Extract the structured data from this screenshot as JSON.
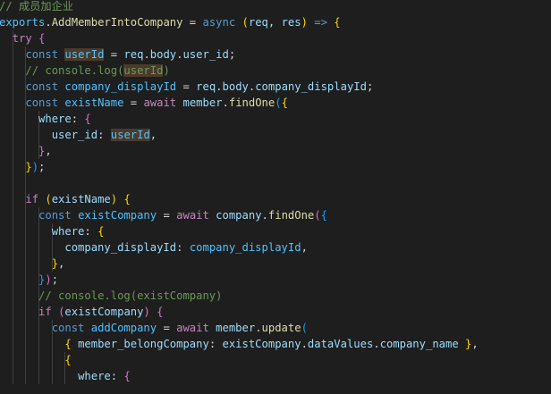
{
  "editor": {
    "theme_colors": {
      "background": "#1e1e1e",
      "comment": "#6a9955",
      "keyword": "#569cd6",
      "control": "#c586c0",
      "variable": "#9cdcfe",
      "const": "#4fc1ff",
      "function": "#dcdcaa",
      "plain": "#d4d4d4",
      "bracket_gold": "#ffd700",
      "bracket_orchid": "#da70d6",
      "bracket_blue": "#179fff",
      "highlight": "#4b3a2a"
    },
    "lines": [
      [
        [
          "comment",
          "// 成员加企业"
        ]
      ],
      [
        [
          "const",
          "exports"
        ],
        [
          "plain",
          "."
        ],
        [
          "func",
          "AddMemberIntoCompany"
        ],
        [
          "plain",
          " = "
        ],
        [
          "keyword",
          "async"
        ],
        [
          "plain",
          " "
        ],
        [
          "b1",
          "("
        ],
        [
          "variable",
          "req"
        ],
        [
          "plain",
          ", "
        ],
        [
          "variable",
          "res"
        ],
        [
          "b1",
          ")"
        ],
        [
          "plain",
          " "
        ],
        [
          "keyword",
          "=>"
        ],
        [
          "plain",
          " "
        ],
        [
          "b1",
          "{"
        ]
      ],
      [
        [
          "plain",
          "  "
        ],
        [
          "control",
          "try"
        ],
        [
          "plain",
          " "
        ],
        [
          "b2",
          "{"
        ]
      ],
      [
        [
          "plain",
          "    "
        ],
        [
          "keyword",
          "const"
        ],
        [
          "plain",
          " "
        ],
        [
          "const_hl",
          "userId"
        ],
        [
          "plain",
          " = "
        ],
        [
          "variable",
          "req"
        ],
        [
          "plain",
          "."
        ],
        [
          "variable",
          "body"
        ],
        [
          "plain",
          "."
        ],
        [
          "variable",
          "user_id"
        ],
        [
          "plain",
          ";"
        ]
      ],
      [
        [
          "plain",
          "    "
        ],
        [
          "comment",
          "// console.log("
        ],
        [
          "comment_hl",
          "userId"
        ],
        [
          "comment",
          ")"
        ]
      ],
      [
        [
          "plain",
          "    "
        ],
        [
          "keyword",
          "const"
        ],
        [
          "plain",
          " "
        ],
        [
          "const",
          "company_displayId"
        ],
        [
          "plain",
          " = "
        ],
        [
          "variable",
          "req"
        ],
        [
          "plain",
          "."
        ],
        [
          "variable",
          "body"
        ],
        [
          "plain",
          "."
        ],
        [
          "variable",
          "company_displayId"
        ],
        [
          "plain",
          ";"
        ]
      ],
      [
        [
          "plain",
          "    "
        ],
        [
          "keyword",
          "const"
        ],
        [
          "plain",
          " "
        ],
        [
          "const",
          "existName"
        ],
        [
          "plain",
          " = "
        ],
        [
          "control",
          "await"
        ],
        [
          "plain",
          " "
        ],
        [
          "variable",
          "member"
        ],
        [
          "plain",
          "."
        ],
        [
          "func",
          "findOne"
        ],
        [
          "b3",
          "("
        ],
        [
          "b1",
          "{"
        ]
      ],
      [
        [
          "plain",
          "      "
        ],
        [
          "variable",
          "where"
        ],
        [
          "plain",
          ": "
        ],
        [
          "b2",
          "{"
        ]
      ],
      [
        [
          "plain",
          "        "
        ],
        [
          "variable",
          "user_id"
        ],
        [
          "plain",
          ": "
        ],
        [
          "const_hl",
          "userId"
        ],
        [
          "plain",
          ","
        ]
      ],
      [
        [
          "plain",
          "      "
        ],
        [
          "b2",
          "}"
        ],
        [
          "plain",
          ","
        ]
      ],
      [
        [
          "plain",
          "    "
        ],
        [
          "b1",
          "}"
        ],
        [
          "b3",
          ")"
        ],
        [
          "plain",
          ";"
        ]
      ],
      [],
      [
        [
          "plain",
          "    "
        ],
        [
          "control",
          "if"
        ],
        [
          "plain",
          " "
        ],
        [
          "b1",
          "("
        ],
        [
          "variable",
          "existName"
        ],
        [
          "b1",
          ")"
        ],
        [
          "plain",
          " "
        ],
        [
          "b1",
          "{"
        ]
      ],
      [
        [
          "plain",
          "      "
        ],
        [
          "keyword",
          "const"
        ],
        [
          "plain",
          " "
        ],
        [
          "const",
          "existCompany"
        ],
        [
          "plain",
          " = "
        ],
        [
          "control",
          "await"
        ],
        [
          "plain",
          " "
        ],
        [
          "variable",
          "company"
        ],
        [
          "plain",
          "."
        ],
        [
          "func",
          "findOne"
        ],
        [
          "b2",
          "("
        ],
        [
          "b3",
          "{"
        ]
      ],
      [
        [
          "plain",
          "        "
        ],
        [
          "variable",
          "where"
        ],
        [
          "plain",
          ": "
        ],
        [
          "b1",
          "{"
        ]
      ],
      [
        [
          "plain",
          "          "
        ],
        [
          "variable",
          "company_displayId"
        ],
        [
          "plain",
          ": "
        ],
        [
          "const",
          "company_displayId"
        ],
        [
          "plain",
          ","
        ]
      ],
      [
        [
          "plain",
          "        "
        ],
        [
          "b1",
          "}"
        ],
        [
          "plain",
          ","
        ]
      ],
      [
        [
          "plain",
          "      "
        ],
        [
          "b3",
          "}"
        ],
        [
          "b2",
          ")"
        ],
        [
          "plain",
          ";"
        ]
      ],
      [
        [
          "plain",
          "      "
        ],
        [
          "comment",
          "// console.log(existCompany)"
        ]
      ],
      [
        [
          "plain",
          "      "
        ],
        [
          "control",
          "if"
        ],
        [
          "plain",
          " "
        ],
        [
          "b2",
          "("
        ],
        [
          "variable",
          "existCompany"
        ],
        [
          "b2",
          ")"
        ],
        [
          "plain",
          " "
        ],
        [
          "b2",
          "{"
        ]
      ],
      [
        [
          "plain",
          "        "
        ],
        [
          "keyword",
          "const"
        ],
        [
          "plain",
          " "
        ],
        [
          "const",
          "addCompany"
        ],
        [
          "plain",
          " = "
        ],
        [
          "control",
          "await"
        ],
        [
          "plain",
          " "
        ],
        [
          "variable",
          "member"
        ],
        [
          "plain",
          "."
        ],
        [
          "func",
          "update"
        ],
        [
          "b3",
          "("
        ]
      ],
      [
        [
          "plain",
          "          "
        ],
        [
          "b1",
          "{"
        ],
        [
          "plain",
          " "
        ],
        [
          "variable",
          "member_belongCompany"
        ],
        [
          "plain",
          ": "
        ],
        [
          "variable",
          "existCompany"
        ],
        [
          "plain",
          "."
        ],
        [
          "variable",
          "dataValues"
        ],
        [
          "plain",
          "."
        ],
        [
          "variable",
          "company_name"
        ],
        [
          "plain",
          " "
        ],
        [
          "b1",
          "}"
        ],
        [
          "plain",
          ","
        ]
      ],
      [
        [
          "plain",
          "          "
        ],
        [
          "b1",
          "{"
        ]
      ],
      [
        [
          "plain",
          "            "
        ],
        [
          "variable",
          "where"
        ],
        [
          "plain",
          ": "
        ],
        [
          "b2",
          "{"
        ]
      ]
    ]
  }
}
